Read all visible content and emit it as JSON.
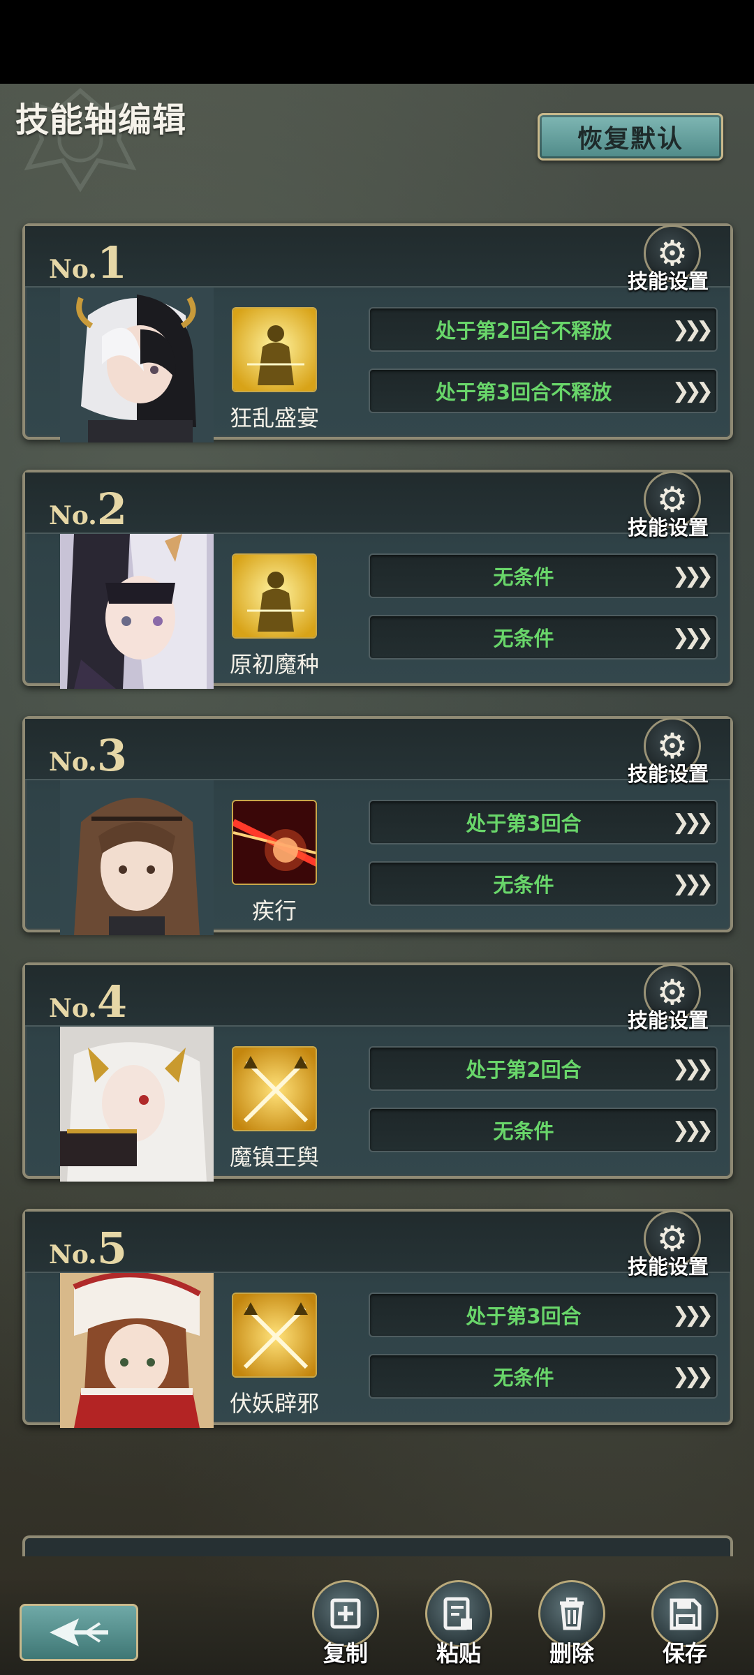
{
  "header": {
    "title": "技能轴编辑",
    "restore_default": "恢复默认"
  },
  "cards": [
    {
      "no_prefix": "No.",
      "no": "1",
      "gear_label": "技能设置",
      "skill_name": "狂乱盛宴",
      "skill_icon": "golden-warrior-icon",
      "conditions": [
        "处于第2回合不释放",
        "处于第3回合不释放"
      ]
    },
    {
      "no_prefix": "No.",
      "no": "2",
      "gear_label": "技能设置",
      "skill_name": "原初魔种",
      "skill_icon": "golden-warrior-icon",
      "conditions": [
        "无条件",
        "无条件"
      ]
    },
    {
      "no_prefix": "No.",
      "no": "3",
      "gear_label": "技能设置",
      "skill_name": "疾行",
      "skill_icon": "red-slash-icon",
      "conditions": [
        "处于第3回合",
        "无条件"
      ]
    },
    {
      "no_prefix": "No.",
      "no": "4",
      "gear_label": "技能设置",
      "skill_name": "魔镇王舆",
      "skill_icon": "crossed-swords-icon",
      "conditions": [
        "处于第2回合",
        "无条件"
      ]
    },
    {
      "no_prefix": "No.",
      "no": "5",
      "gear_label": "技能设置",
      "skill_name": "伏妖辟邪",
      "skill_icon": "crossed-swords-icon",
      "conditions": [
        "处于第3回合",
        "无条件"
      ]
    }
  ],
  "arrows": "❯❯❯",
  "toolbar": {
    "copy": "复制",
    "paste": "粘贴",
    "delete": "删除",
    "save": "保存"
  },
  "colors": {
    "condition_text": "#69d66a",
    "card_number": "#e6d7a6",
    "button_teal": "#6fa9a7",
    "frame_gold": "#8f8a74"
  }
}
